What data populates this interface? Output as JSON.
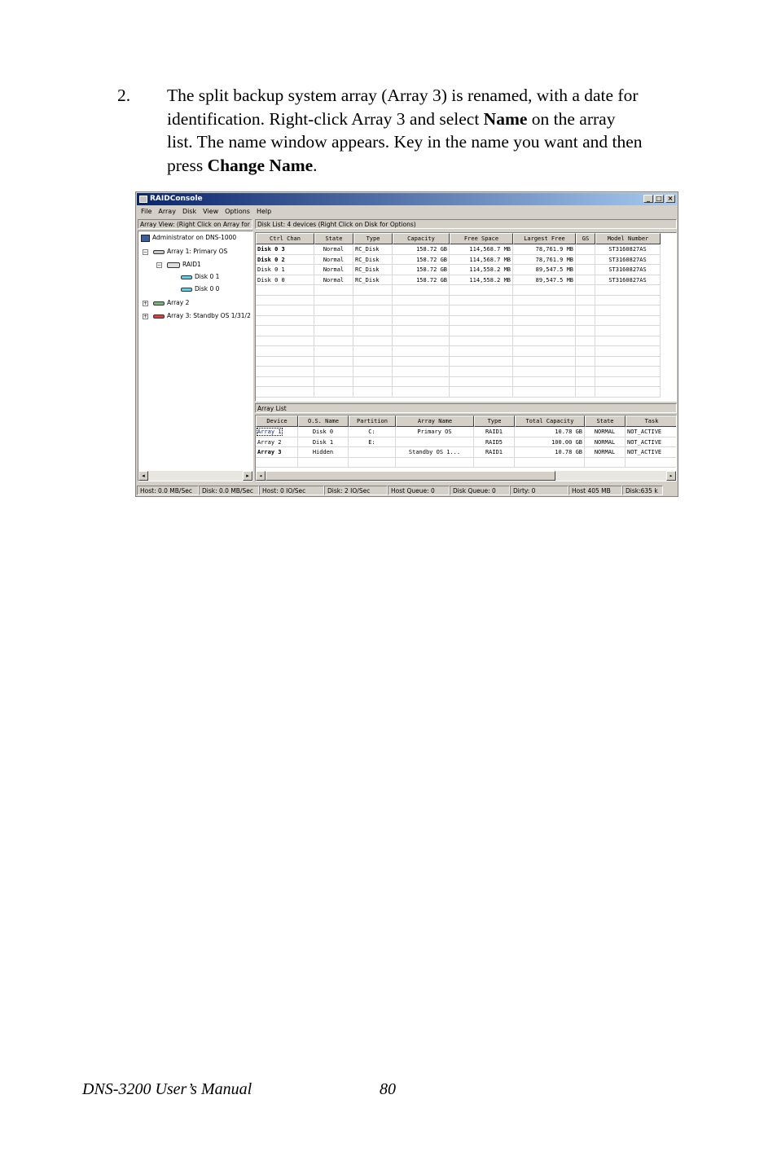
{
  "step": {
    "number": "2.",
    "line1": "The split backup system array (Array 3) is renamed, with a date for",
    "line2_a": "identification. Right-click Array 3 and select ",
    "line2_b": "Name",
    "line2_c": " on the array",
    "line3": "list. The name window appears. Key in the name you want and then",
    "line4_a": "press ",
    "line4_b": "Change Name",
    "line4_c": "."
  },
  "window": {
    "title": "RAIDConsole",
    "min": "_",
    "max": "□",
    "close": "×",
    "menu": [
      "File",
      "Array",
      "Disk",
      "View",
      "Options",
      "Help"
    ],
    "array_view_label": "Array View: (Right Click on Array for Options)",
    "disk_list_label": "Disk List: 4 devices (Right Click on Disk for Options)",
    "array_list_label": "Array List",
    "tree": {
      "root": "Administrator on DNS-1000",
      "array1": "Array 1: Primary OS",
      "raid1": "RAID1",
      "disk01": "Disk 0 1",
      "disk00": "Disk 0 0",
      "array2": "Array 2",
      "array3": "Array 3: Standby OS 1/31/2"
    },
    "disk_table": {
      "headers": [
        "Ctrl Chan",
        "State",
        "Type",
        "Capacity",
        "Free Space",
        "Largest Free",
        "GS",
        "Model Number"
      ],
      "rows": [
        [
          "Disk  0 3",
          "Normal",
          "RC_Disk",
          "158.72 GB",
          "114,568.7 MB",
          "78,761.9 MB",
          "",
          "ST3160827AS"
        ],
        [
          "Disk  0 2",
          "Normal",
          "RC_Disk",
          "158.72 GB",
          "114,568.7 MB",
          "78,761.9 MB",
          "",
          "ST3160827AS"
        ],
        [
          "Disk  0 1",
          "Normal",
          "RC_Disk",
          "158.72 GB",
          "114,558.2 MB",
          "89,547.5 MB",
          "",
          "ST3160827AS"
        ],
        [
          "Disk  0 0",
          "Normal",
          "RC_Disk",
          "158.72 GB",
          "114,558.2 MB",
          "89,547.5 MB",
          "",
          "ST3160827AS"
        ]
      ]
    },
    "array_table": {
      "headers": [
        "Device",
        "O.S. Name",
        "Partition",
        "Array Name",
        "Type",
        "Total Capacity",
        "State",
        "Task"
      ],
      "rows": [
        [
          "Array 1",
          "Disk 0",
          "C:",
          "Primary OS",
          "RAID1",
          "10.78 GB",
          "NORMAL",
          "NOT_ACTIVE"
        ],
        [
          "Array 2",
          "Disk 1",
          "E:",
          "",
          "RAID5",
          "100.00 GB",
          "NORMAL",
          "NOT_ACTIVE"
        ],
        [
          "Array 3",
          "Hidden",
          "",
          "Standby OS 1...",
          "RAID1",
          "10.78 GB",
          "NORMAL",
          "NOT_ACTIVE"
        ]
      ]
    },
    "status": [
      "Host: 0.0 MB/Sec",
      "Disk: 0.0 MB/Sec",
      "Host: 0 IO/Sec",
      "Disk: 2 IO/Sec",
      "Host Queue: 0",
      "Disk Queue: 0",
      "Dirty: 0",
      "Host 405 MB",
      "Disk:635 k"
    ]
  },
  "footer": {
    "manual": "DNS-3200 User’s Manual",
    "page": "80"
  }
}
